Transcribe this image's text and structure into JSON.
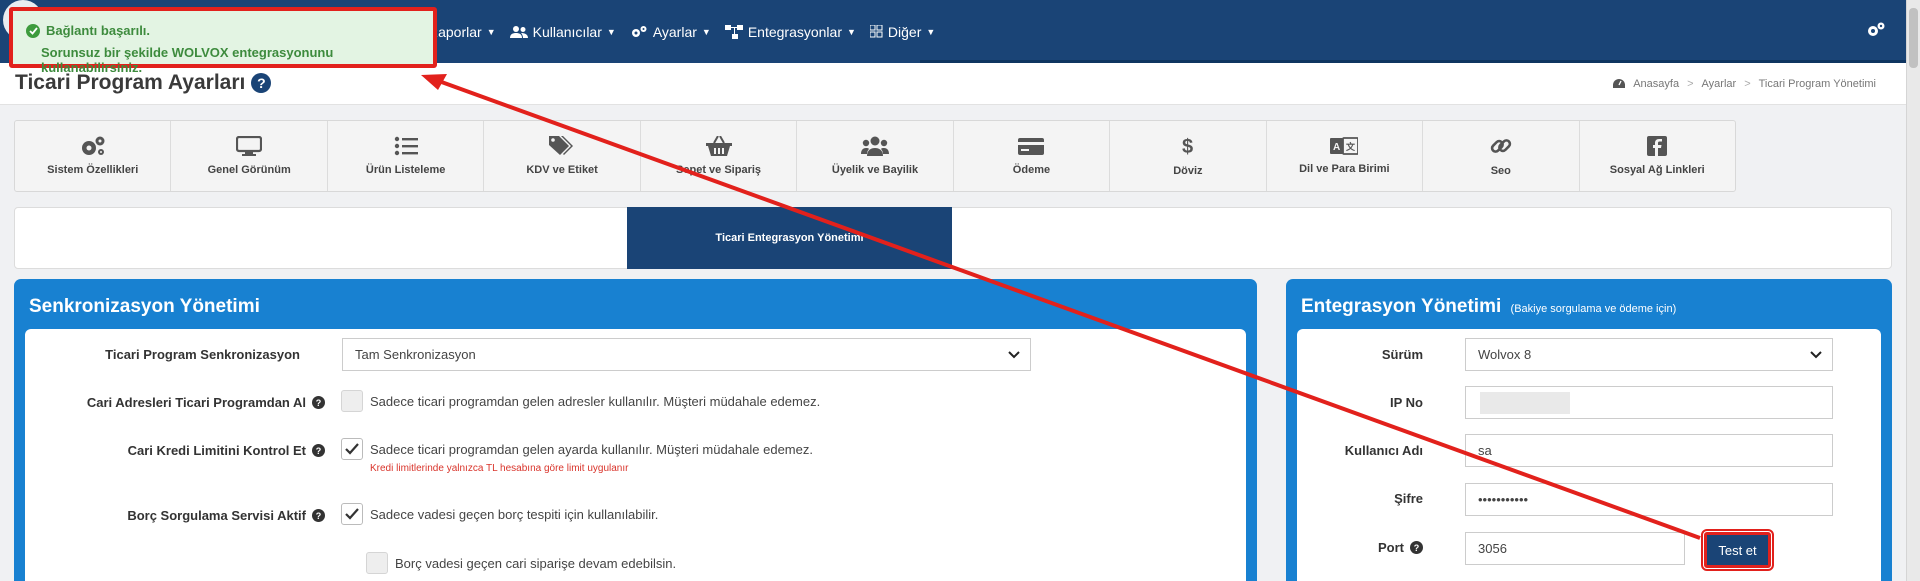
{
  "toast": {
    "title": "Bağlantı başarılı.",
    "message": "Sorunsuz bir şekilde WOLVOX entegrasyonunu kullanabilirsiniz."
  },
  "nav": {
    "items": [
      {
        "label": "Raporlar",
        "icon": "report-icon"
      },
      {
        "label": "Kullanıcılar",
        "icon": "users-icon"
      },
      {
        "label": "Ayarlar",
        "icon": "gears-icon"
      },
      {
        "label": "Entegrasyonlar",
        "icon": "sitemap-icon"
      },
      {
        "label": "Diğer",
        "icon": "grid-icon"
      }
    ]
  },
  "page": {
    "title": "Ticari Program Ayarları",
    "breadcrumb": [
      "Anasayfa",
      "Ayarlar",
      "Ticari Program Yönetimi"
    ]
  },
  "tabs": [
    {
      "label": "Sistem Özellikleri",
      "icon": "cogs-icon"
    },
    {
      "label": "Genel Görünüm",
      "icon": "monitor-icon"
    },
    {
      "label": "Ürün Listeleme",
      "icon": "list-icon"
    },
    {
      "label": "KDV ve Etiket",
      "icon": "tags-icon"
    },
    {
      "label": "Sepet ve Sipariş",
      "icon": "basket-icon"
    },
    {
      "label": "Üyelik ve Bayilik",
      "icon": "users-icon"
    },
    {
      "label": "Ödeme",
      "icon": "credit-card-icon"
    },
    {
      "label": "Döviz",
      "icon": "dollar-icon"
    },
    {
      "label": "Dil ve Para Birimi",
      "icon": "language-icon"
    },
    {
      "label": "Seo",
      "icon": "link-icon"
    },
    {
      "label": "Sosyal Ağ Linkleri",
      "icon": "facebook-icon"
    }
  ],
  "subtab": {
    "label": "Ticari Entegrasyon Yönetimi"
  },
  "sync": {
    "title": "Senkronizasyon Yönetimi",
    "program_label": "Ticari Program Senkronizasyon",
    "program_value": "Tam Senkronizasyon",
    "address_label": "Cari Adresleri Ticari Programdan Al",
    "address_text": "Sadece ticari programdan gelen adresler kullanılır. Müşteri müdahale edemez.",
    "credit_label": "Cari Kredi Limitini Kontrol Et",
    "credit_text": "Sadece ticari programdan gelen ayarda kullanılır. Müşteri müdahale edemez.",
    "credit_note": "Kredi limitlerinde yalnızca TL hesabına göre limit uygulanır",
    "debt_label": "Borç Sorgulama Servisi Aktif",
    "debt_text": "Sadece vadesi geçen borç tespiti için kullanılabilir.",
    "overdue_text": "Borç vadesi geçen cari siparişe devam edebilsin."
  },
  "integration": {
    "title": "Entegrasyon Yönetimi",
    "subtitle": "(Bakiye sorgulama ve ödeme için)",
    "version_label": "Sürüm",
    "version_value": "Wolvox 8",
    "ip_label": "IP No",
    "ip_value": "",
    "user_label": "Kullanıcı Adı",
    "user_value": "sa",
    "password_label": "Şifre",
    "password_value": "•••••••••••",
    "port_label": "Port",
    "port_value": "3056",
    "test_button": "Test et"
  }
}
